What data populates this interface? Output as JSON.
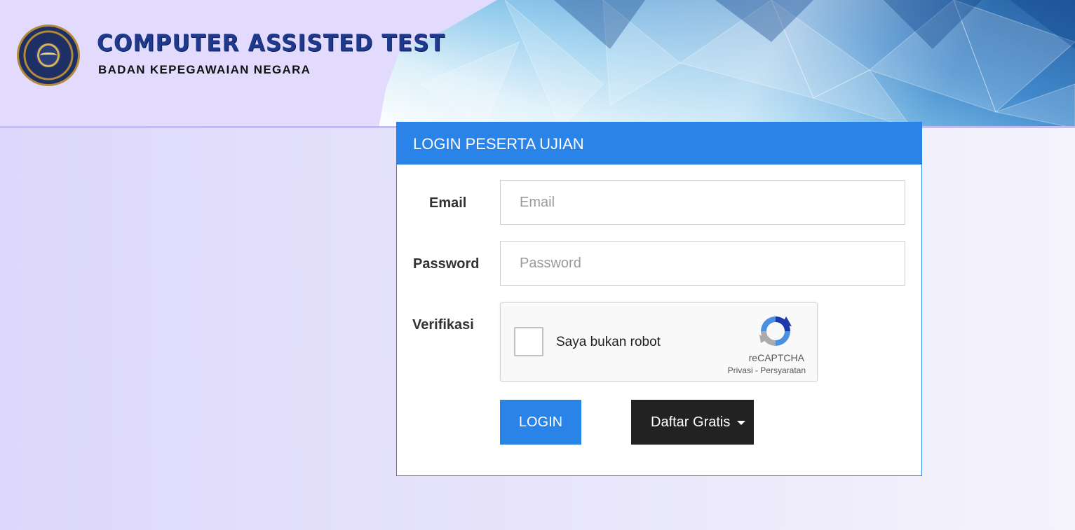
{
  "header": {
    "brand_title": "COMPUTER ASSISTED TEST",
    "brand_subtitle": "BADAN KEPEGAWAIAN NEGARA",
    "logo_icon": "bkn-emblem-icon"
  },
  "login": {
    "title": "LOGIN PESERTA UJIAN",
    "email_label": "Email",
    "email_placeholder": "Email",
    "email_value": "",
    "password_label": "Password",
    "password_placeholder": "Password",
    "password_value": "",
    "verification_label": "Verifikasi",
    "captcha": {
      "checkbox_text": "Saya bukan robot",
      "brand": "reCAPTCHA",
      "links": "Privasi - Persyaratan",
      "icon": "recaptcha-icon"
    },
    "login_button": "LOGIN",
    "register_button": "Daftar Gratis"
  },
  "colors": {
    "primary": "#2a83e6",
    "dark_button": "#222222",
    "header_bg": "#e2dbfd",
    "brand_blue": "#1f3a8c"
  }
}
